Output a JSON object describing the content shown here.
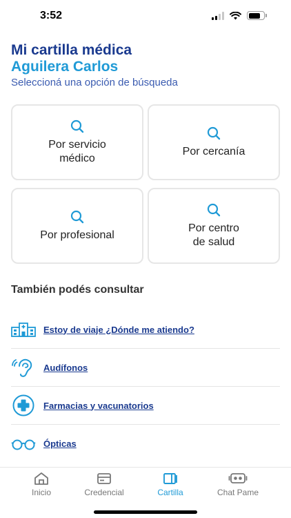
{
  "status_bar": {
    "time": "3:52"
  },
  "header": {
    "title": "Mi cartilla médica",
    "name": "Aguilera Carlos",
    "subtitle": "Seleccioná una opción de búsqueda"
  },
  "search_options": [
    {
      "label": "Por servicio\nmédico",
      "icon": "search-icon"
    },
    {
      "label": "Por cercanía",
      "icon": "search-icon"
    },
    {
      "label": "Por profesional",
      "icon": "search-icon"
    },
    {
      "label": "Por centro\nde salud",
      "icon": "search-icon"
    }
  ],
  "section": {
    "title": "También podés consultar"
  },
  "links": [
    {
      "label": "Estoy de viaje ¿Dónde me atiendo?",
      "icon": "hospital-building-icon"
    },
    {
      "label": "Audífonos",
      "icon": "ear-hearing-icon"
    },
    {
      "label": "Farmacias y vacunatorios",
      "icon": "pharmacy-cross-icon"
    },
    {
      "label": "Ópticas",
      "icon": "eyeglasses-icon"
    }
  ],
  "tabbar": {
    "tabs": [
      {
        "label": "Inicio",
        "icon": "home-icon"
      },
      {
        "label": "Credencial",
        "icon": "card-icon"
      },
      {
        "label": "Cartilla",
        "icon": "book-icon"
      },
      {
        "label": "Chat Pame",
        "icon": "chat-bot-icon"
      }
    ],
    "active_index": 2
  },
  "colors": {
    "primary_dark": "#1a3a8f",
    "primary_light": "#1f9ad6",
    "border": "#e6e6e6"
  }
}
